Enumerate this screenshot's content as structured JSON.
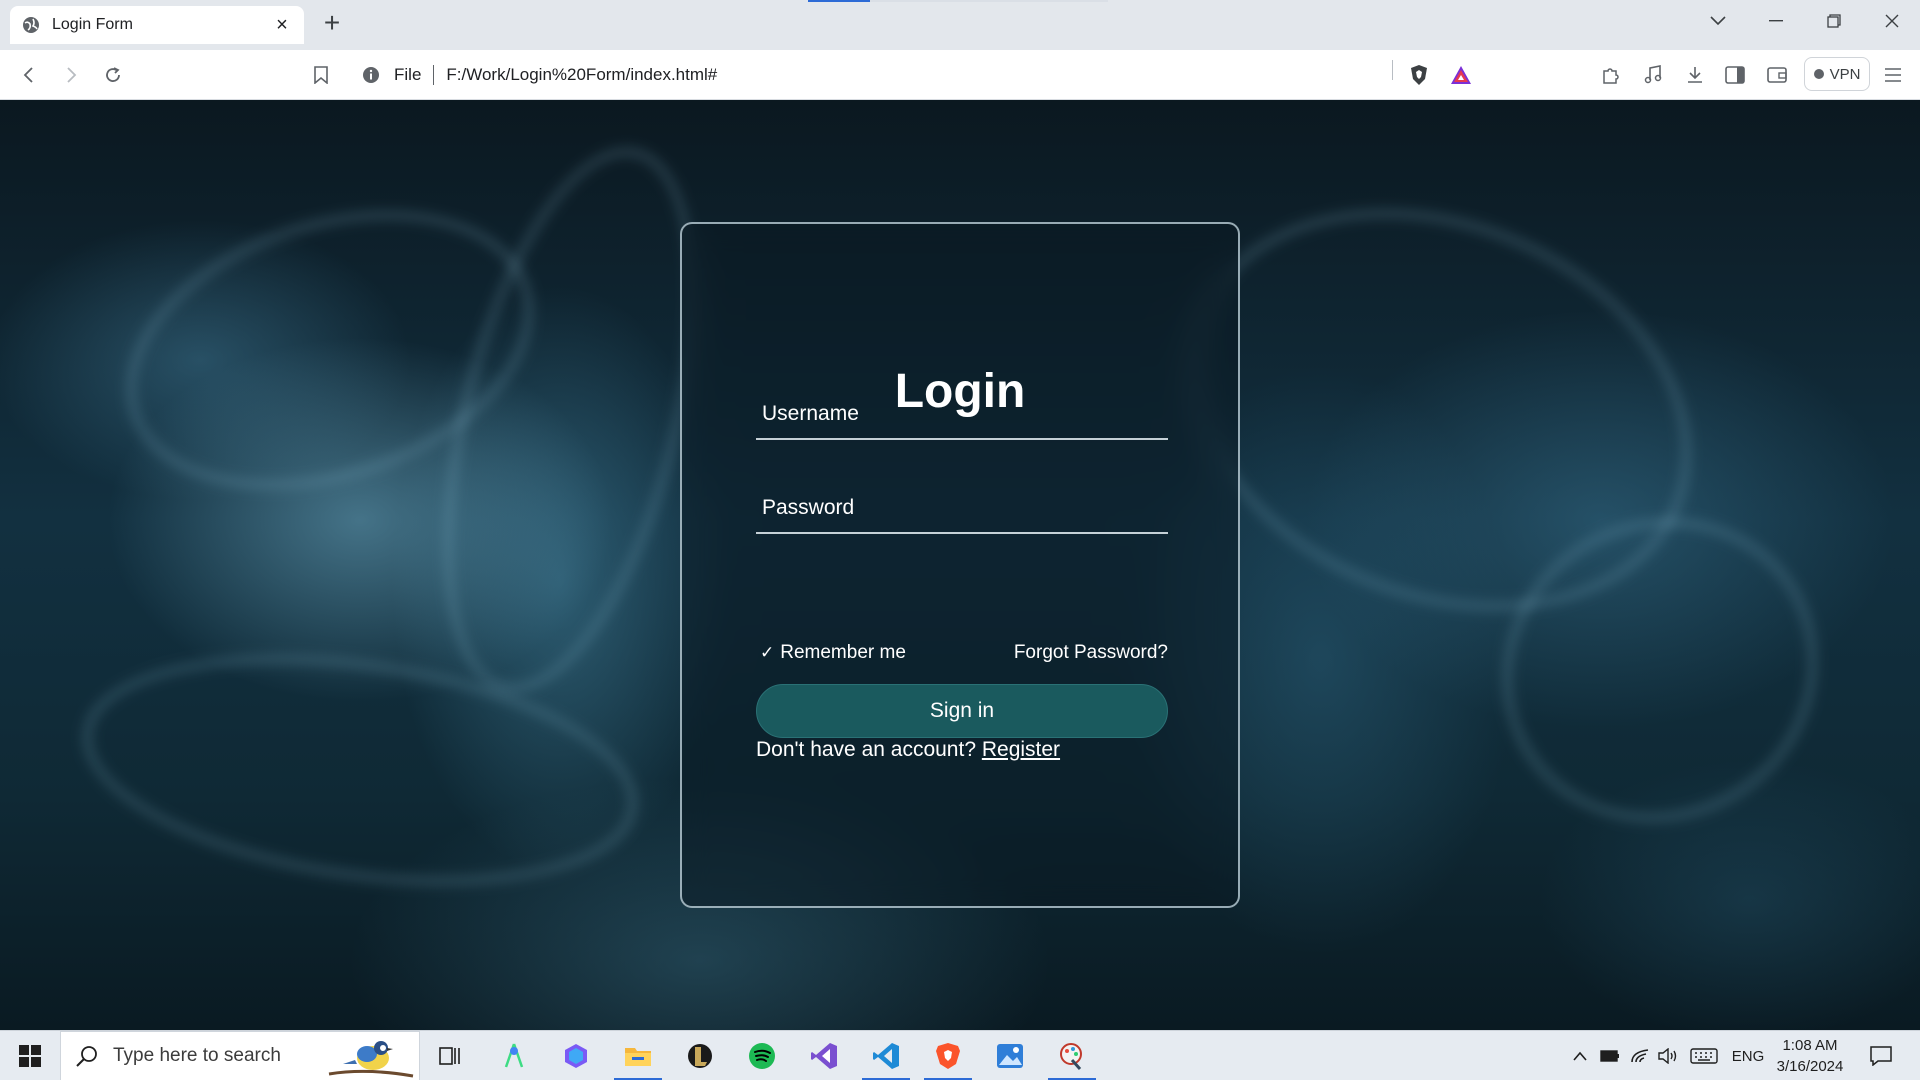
{
  "browser": {
    "tab_title": "Login Form",
    "tab_close": "×",
    "new_tab": "+",
    "url_scheme": "File",
    "url": "F:/Work/Login%20Form/index.html#",
    "vpn_label": "VPN"
  },
  "login": {
    "title": "Login",
    "username_placeholder": "Username",
    "password_placeholder": "Password",
    "remember_check": "✓",
    "remember_label": "Remember me",
    "forgot_label": "Forgot Password?",
    "signin_label": "Sign in",
    "register_prompt": "Don't have an account?",
    "register_link": "Register"
  },
  "taskbar": {
    "search_placeholder": "Type here to search",
    "apps": [
      {
        "name": "task-view-icon"
      },
      {
        "name": "android-studio-icon"
      },
      {
        "name": "copilot-icon"
      },
      {
        "name": "file-explorer-icon"
      },
      {
        "name": "league-of-legends-icon"
      },
      {
        "name": "spotify-icon"
      },
      {
        "name": "visual-studio-icon"
      },
      {
        "name": "vscode-icon"
      },
      {
        "name": "brave-icon"
      },
      {
        "name": "photos-icon"
      },
      {
        "name": "paint-icon"
      }
    ],
    "language": "ENG",
    "time": "1:08 AM",
    "date": "3/16/2024"
  },
  "colors": {
    "signin_button": "#1a5a5e",
    "taskbar_bg": "#e6ebf1",
    "accent": "#2d6bd6"
  }
}
